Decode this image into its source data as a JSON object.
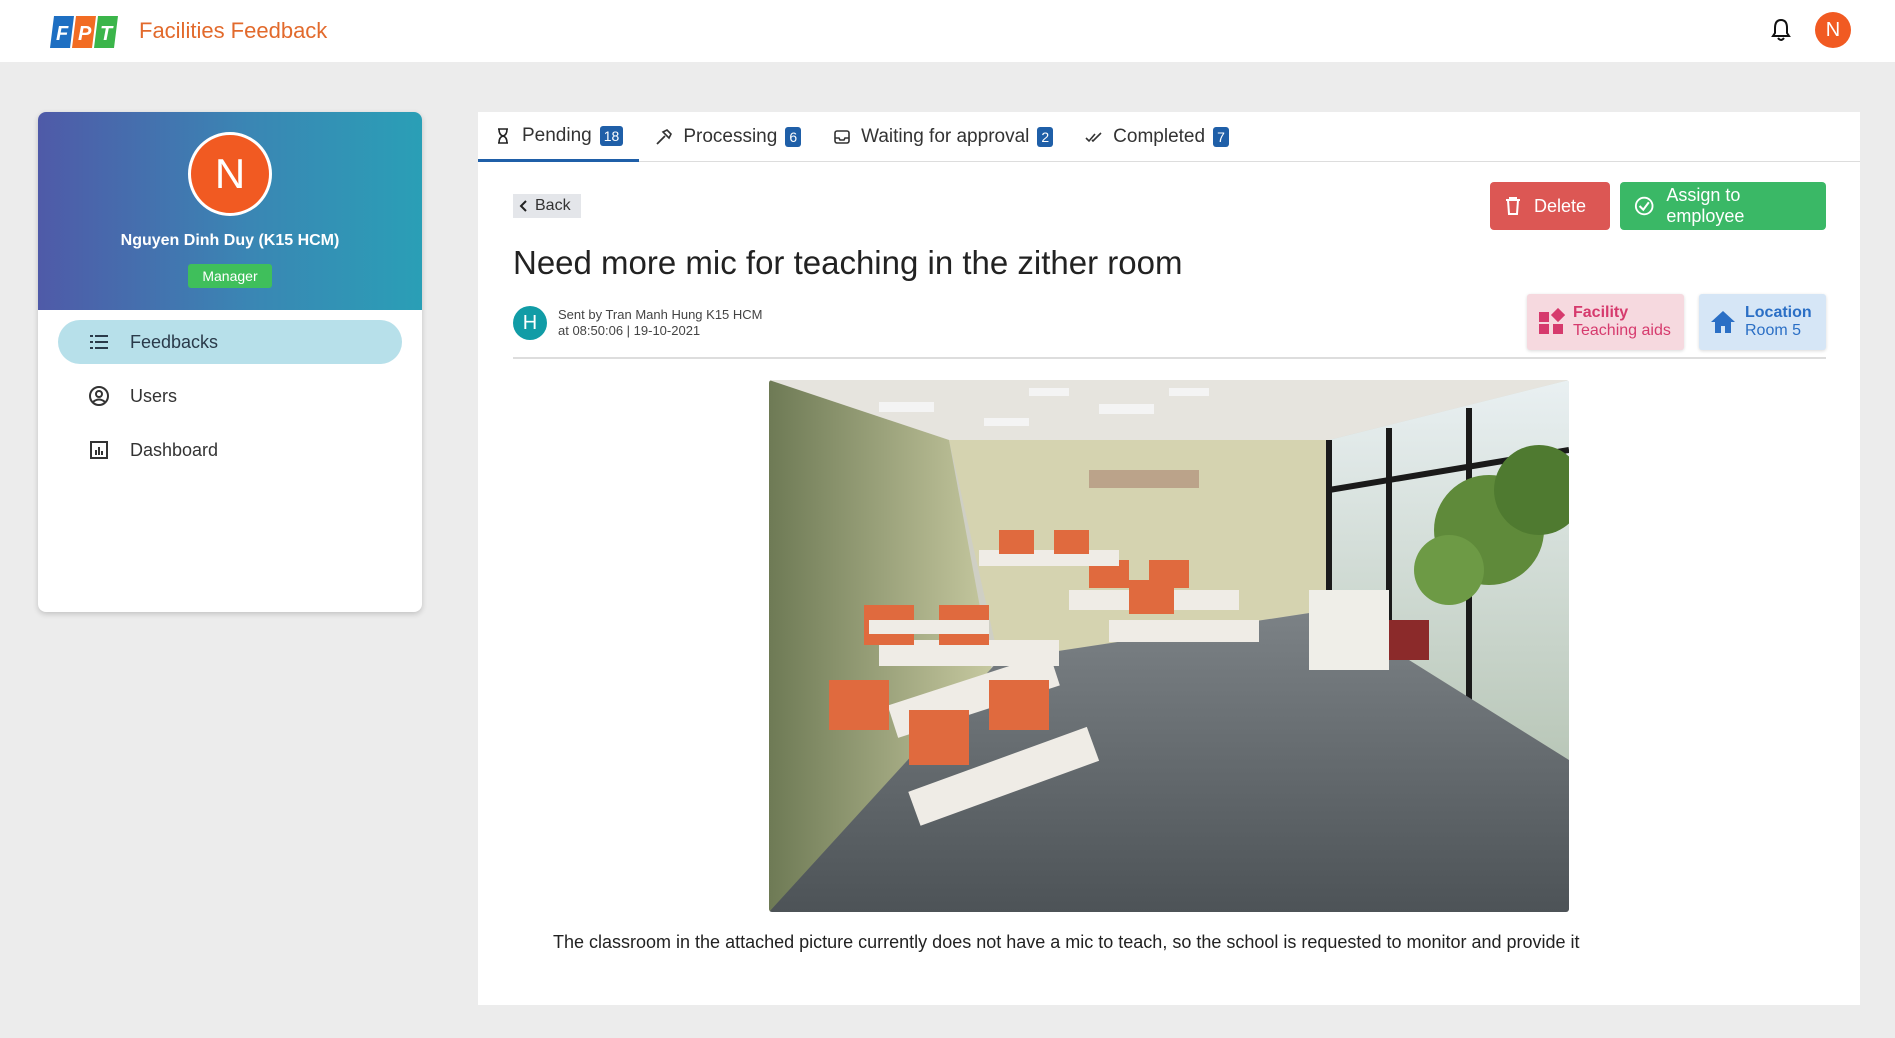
{
  "header": {
    "logo_text": "FPT",
    "app_title": "Facilities Feedback",
    "avatar_initial": "N"
  },
  "sidebar": {
    "avatar_initial": "N",
    "user_name": "Nguyen Dinh Duy (K15 HCM)",
    "role": "Manager",
    "items": [
      {
        "label": "Feedbacks",
        "icon": "list-icon",
        "active": true
      },
      {
        "label": "Users",
        "icon": "user-circle-icon",
        "active": false
      },
      {
        "label": "Dashboard",
        "icon": "bar-chart-icon",
        "active": false
      }
    ]
  },
  "tabs": [
    {
      "label": "Pending",
      "count": "18",
      "icon": "hourglass-icon",
      "active": true
    },
    {
      "label": "Processing",
      "count": "6",
      "icon": "hammer-icon",
      "active": false
    },
    {
      "label": "Waiting for approval",
      "count": "2",
      "icon": "inbox-icon",
      "active": false
    },
    {
      "label": "Completed",
      "count": "7",
      "icon": "double-check-icon",
      "active": false
    }
  ],
  "feedback": {
    "back_label": "Back",
    "delete_label": "Delete",
    "assign_label": "Assign to employee",
    "title": "Need more mic for teaching in the zither room",
    "sender_initial": "H",
    "sent_by": "Sent by Tran Manh Hung K15 HCM",
    "sent_at": "at 08:50:06 | 19-10-2021",
    "facility_label": "Facility",
    "facility_value": "Teaching aids",
    "location_label": "Location",
    "location_value": "Room 5",
    "description": "The classroom in the attached picture currently does not have a mic to teach, so the school is requested to monitor and provide it"
  },
  "colors": {
    "brand_orange": "#e26a2c",
    "accent_blue": "#1f5fa8",
    "delete_red": "#dc5754",
    "assign_green": "#3ab866",
    "manager_green": "#3fbf5b"
  }
}
